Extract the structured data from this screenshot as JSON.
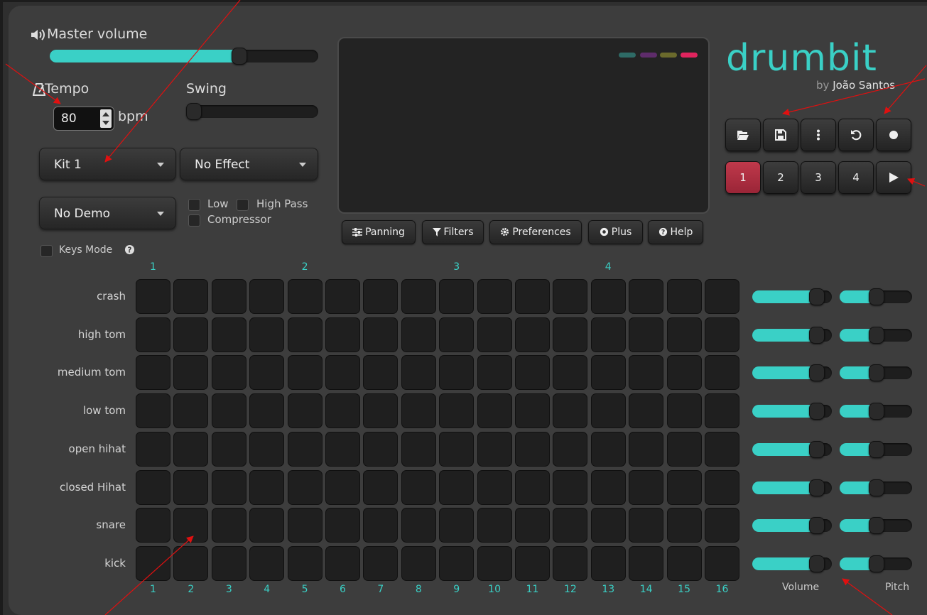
{
  "master": {
    "label": "Master volume",
    "volume_pct": 71
  },
  "tempo": {
    "label": "Tempo",
    "value": "80",
    "unit": "bpm"
  },
  "swing": {
    "label": "Swing",
    "value_pct": 0
  },
  "kit_select": "Kit 1",
  "effect_select": "No Effect",
  "demo_select": "No Demo",
  "filters": {
    "low": "Low",
    "high_pass": "High Pass",
    "compressor": "Compressor"
  },
  "keys_mode": "Keys Mode",
  "screen_dots": [
    "#2e6b66",
    "#5e2c6b",
    "#6b6a2c",
    "#e0245e"
  ],
  "toolbar": {
    "panning": "Panning",
    "filters": "Filters",
    "preferences": "Preferences",
    "plus": "Plus",
    "help": "Help"
  },
  "logo": {
    "name": "drumbit",
    "by": "by",
    "author": "João Santos"
  },
  "pattern_buttons": [
    "1",
    "2",
    "3",
    "4"
  ],
  "active_pattern": "1",
  "beats": [
    "1",
    "2",
    "3",
    "4"
  ],
  "tracks": [
    {
      "name": "crash",
      "volume_pct": 80,
      "pitch_pct": 50
    },
    {
      "name": "high tom",
      "volume_pct": 80,
      "pitch_pct": 50
    },
    {
      "name": "medium tom",
      "volume_pct": 80,
      "pitch_pct": 50
    },
    {
      "name": "low tom",
      "volume_pct": 80,
      "pitch_pct": 50
    },
    {
      "name": "open hihat",
      "volume_pct": 80,
      "pitch_pct": 50
    },
    {
      "name": "closed Hihat",
      "volume_pct": 80,
      "pitch_pct": 50
    },
    {
      "name": "snare",
      "volume_pct": 80,
      "pitch_pct": 50
    },
    {
      "name": "kick",
      "volume_pct": 80,
      "pitch_pct": 50
    }
  ],
  "steps": [
    "1",
    "2",
    "3",
    "4",
    "5",
    "6",
    "7",
    "8",
    "9",
    "10",
    "11",
    "12",
    "13",
    "14",
    "15",
    "16"
  ],
  "footer": {
    "volume": "Volume",
    "pitch": "Pitch"
  },
  "colors": {
    "accent": "#3ad0c6",
    "active": "#b02e42",
    "arrow": "#e01010"
  }
}
